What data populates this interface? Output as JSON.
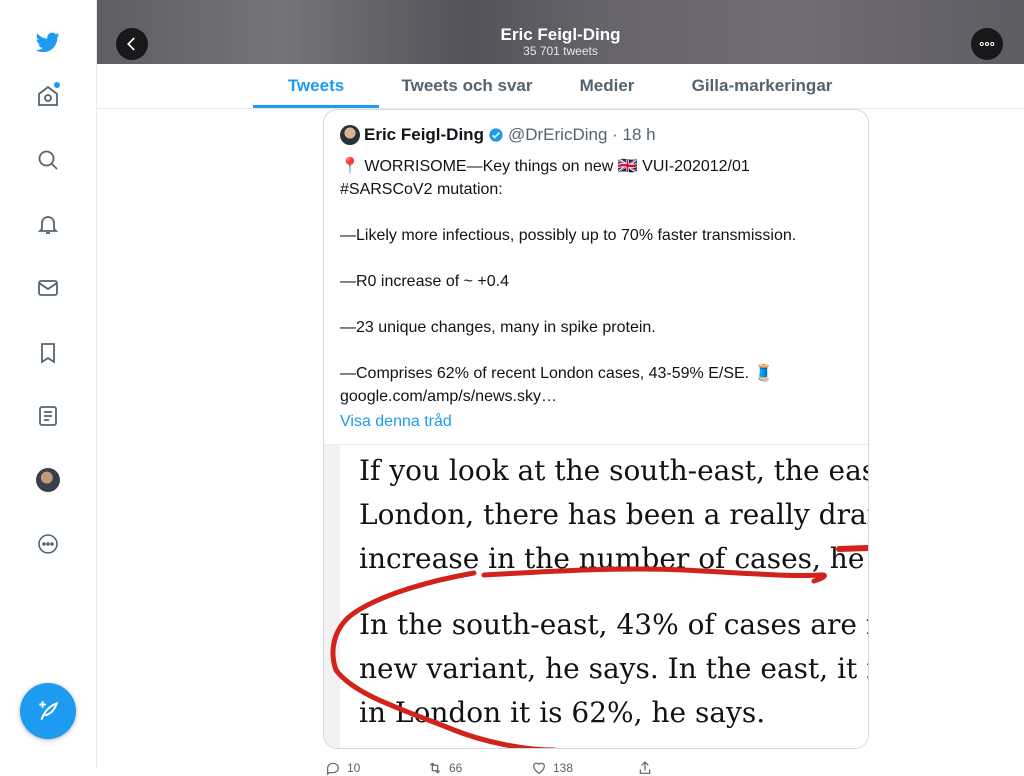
{
  "app": {
    "brand_color": "#1d9bf0"
  },
  "sidebar": {
    "items": [
      {
        "name": "twitter-logo-icon"
      },
      {
        "name": "home-icon"
      },
      {
        "name": "explore-icon"
      },
      {
        "name": "notifications-icon"
      },
      {
        "name": "messages-icon"
      },
      {
        "name": "bookmarks-icon"
      },
      {
        "name": "lists-icon"
      },
      {
        "name": "profile-avatar"
      },
      {
        "name": "more-icon"
      }
    ],
    "compose_icon": "compose-tweet-icon"
  },
  "header": {
    "title": "Eric Feigl-Ding",
    "subtitle": "35 701 tweets"
  },
  "tabs": [
    {
      "label": "Tweets",
      "active": true
    },
    {
      "label": "Tweets och svar",
      "active": false
    },
    {
      "label": "Medier",
      "active": false
    },
    {
      "label": "Gilla-markeringar",
      "active": false
    }
  ],
  "tweet": {
    "author_name": "Eric Feigl-Ding",
    "handle_time": "@DrEricDing · 18 h",
    "text": "📍 WORRISOME—Key things on new 🇬🇧 VUI-202012/01\n#SARSCoV2 mutation:\n\n—Likely more infectious, possibly up to 70% faster transmission.\n\n—R0 increase of ~ +0.4\n\n—23 unique changes, many in spike protein.\n\n—Comprises 62% of recent London cases, 43-59% E/SE. 🧵\ngoogle.com/amp/s/news.sky…",
    "show_thread": "Visa denna tråd",
    "image_text": {
      "line1": "If you look at the south-east, the eas",
      "line2": "London, there has been a really dran",
      "line3": "increase in the number of cases, he s",
      "line4": "In the south-east, 43% of cases are n",
      "line5": "new variant, he says. In the east, it i",
      "line6": "in London it is 62%, he says."
    },
    "actions": {
      "replies": "10",
      "retweets": "66",
      "likes": "138"
    }
  }
}
